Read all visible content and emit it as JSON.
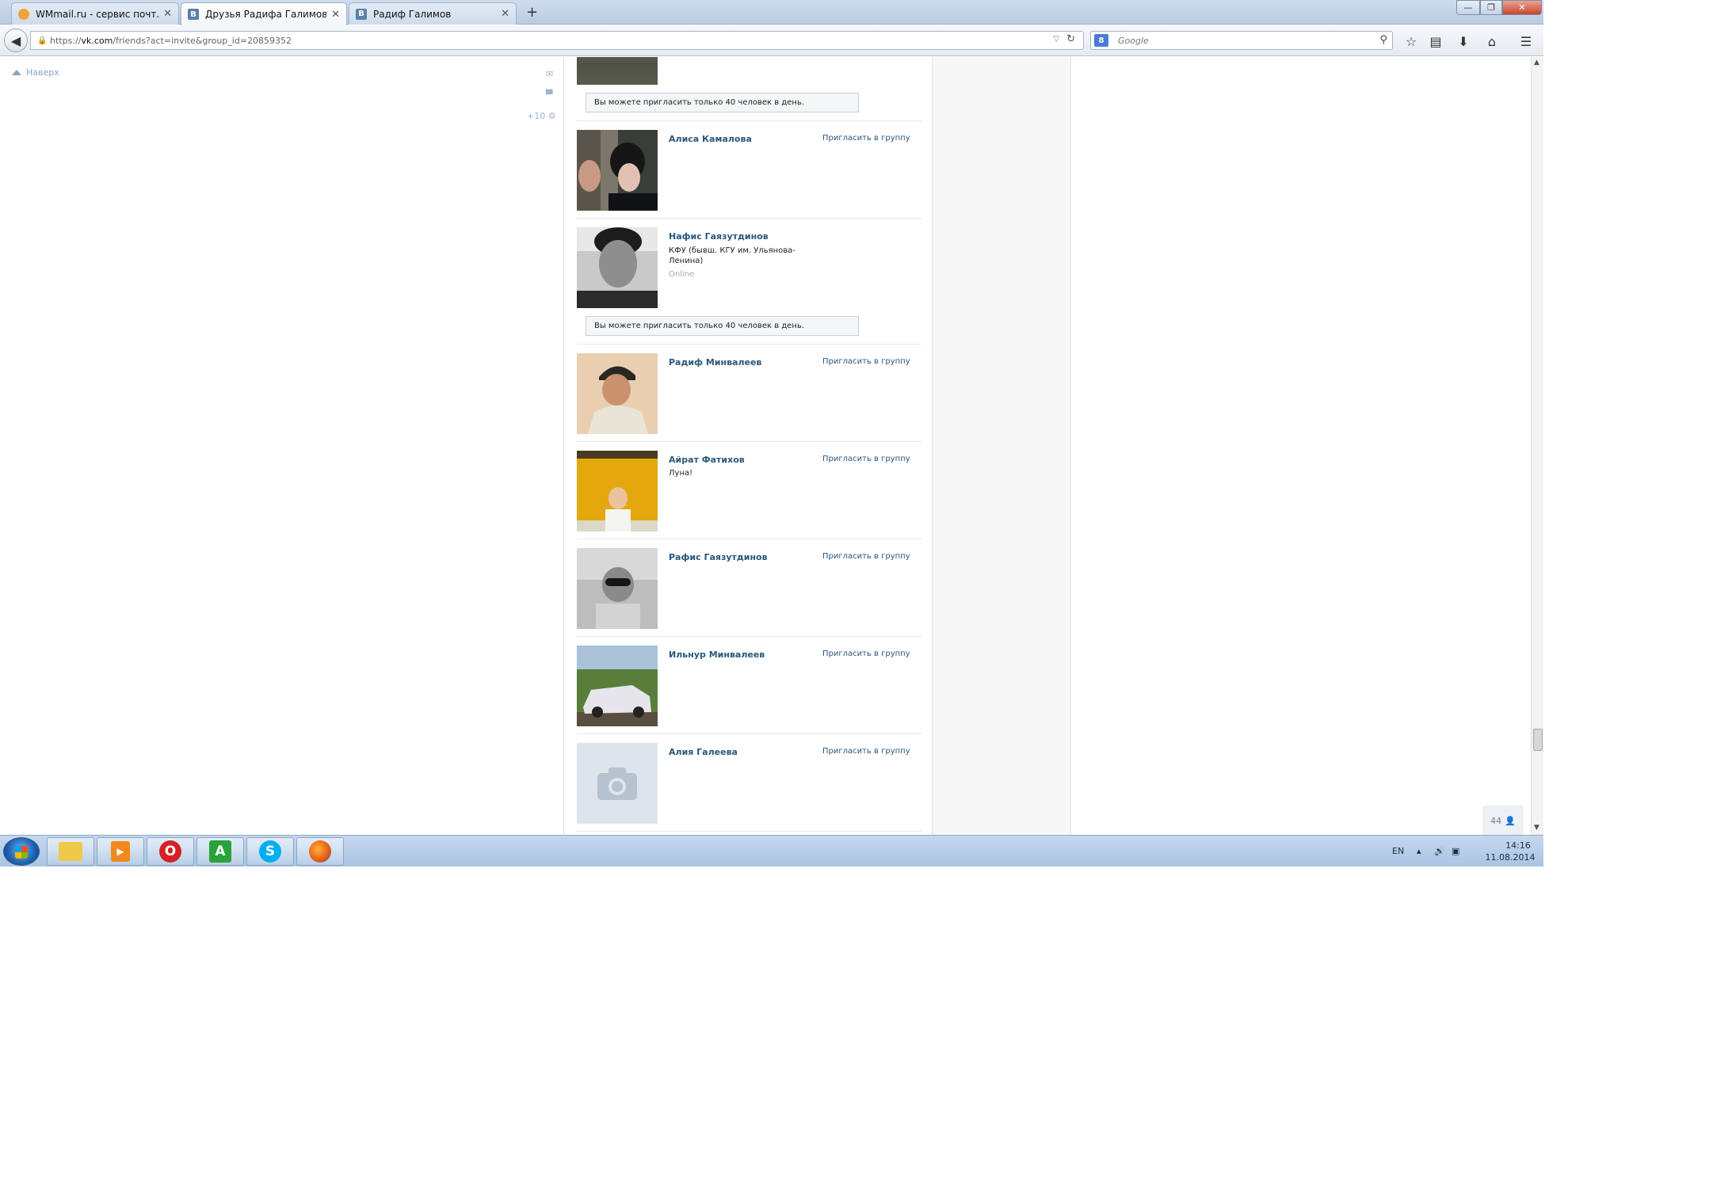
{
  "tabs": [
    {
      "title": "WMmail.ru - сервис почт...",
      "favicon": "wmmail-favicon"
    },
    {
      "title": "Друзья Радифа Галимова ...",
      "favicon": "vk-favicon"
    },
    {
      "title": "Радиф Галимов",
      "favicon": "vk-favicon"
    }
  ],
  "toolbar": {
    "url_prefix": "https://",
    "url_host": "vk.com",
    "url_path": "/friends?act=invite&group_id=20859352",
    "search_placeholder": "Google",
    "vk_badge": "B",
    "google_badge": "8"
  },
  "sidebar": {
    "up_label": "Наверх",
    "counter": "+10"
  },
  "notice_text": "Вы можете пригласить только 40 человек в день.",
  "friends": [
    {
      "name": "Алиса Камалова",
      "info": "",
      "status": "",
      "invite": "Пригласить в группу"
    },
    {
      "name": "Нафис Гаязутдинов",
      "info": "КФУ (бывш. КГУ им. Ульянова-Ленина)",
      "status": "Online",
      "invite": ""
    },
    {
      "name": "Радиф Минвалеев",
      "info": "",
      "status": "",
      "invite": "Пригласить в группу"
    },
    {
      "name": "Айрат Фатихов",
      "info": "Луна!",
      "status": "",
      "invite": "Пригласить в группу"
    },
    {
      "name": "Рафис Гаязутдинов",
      "info": "",
      "status": "",
      "invite": "Пригласить в группу"
    },
    {
      "name": "Ильнур Минвалеев",
      "info": "",
      "status": "",
      "invite": "Пригласить в группу"
    },
    {
      "name": "Алия Галеева",
      "info": "",
      "status": "",
      "invite": "Пригласить в группу"
    }
  ],
  "online_counter": "44",
  "taskbar": {
    "apps": [
      "explorer",
      "media-player",
      "opera",
      "ardown",
      "skype",
      "firefox"
    ],
    "language": "EN",
    "time": "14:16",
    "date": "11.08.2014"
  },
  "colors": {
    "vk_link": "#2b587a",
    "tabbar": "#c5d5ea",
    "taskbar": "#b6cde8"
  }
}
